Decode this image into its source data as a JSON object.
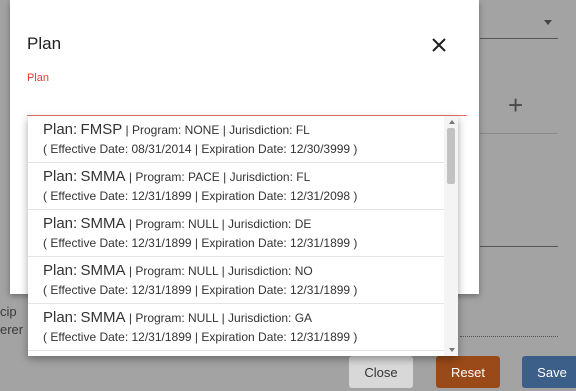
{
  "modal": {
    "title": "Plan",
    "field_label": "Plan",
    "close_icon": "close-icon"
  },
  "options": [
    {
      "plan_label": "Plan:",
      "plan": "FMSP",
      "details": " | Program: NONE | Jurisdiction: FL",
      "dates": "( Effective Date: 08/31/2014 | Expiration Date: 12/30/3999 )"
    },
    {
      "plan_label": "Plan:",
      "plan": "SMMA",
      "details": " | Program: PACE | Jurisdiction: FL",
      "dates": "( Effective Date: 12/31/1899 | Expiration Date: 12/31/2098 )"
    },
    {
      "plan_label": "Plan:",
      "plan": "SMMA",
      "details": " | Program: NULL | Jurisdiction: DE",
      "dates": "( Effective Date: 12/31/1899 | Expiration Date: 12/31/1899 )"
    },
    {
      "plan_label": "Plan:",
      "plan": "SMMA",
      "details": " | Program: NULL | Jurisdiction: NO",
      "dates": "( Effective Date: 12/31/1899 | Expiration Date: 12/31/1899 )"
    },
    {
      "plan_label": "Plan:",
      "plan": "SMMA",
      "details": " | Program: NULL | Jurisdiction: GA",
      "dates": "( Effective Date: 12/31/1899 | Expiration Date: 12/31/1899 )"
    }
  ],
  "background": {
    "text_a": "cip",
    "text_b": "erer",
    "plus": "+",
    "buttons": {
      "close": "Close",
      "reset": "Reset",
      "save": "Save"
    }
  },
  "colors": {
    "field_accent": "#e53935",
    "reset_button": "#9a4a18",
    "save_button": "#3c5f8a"
  }
}
